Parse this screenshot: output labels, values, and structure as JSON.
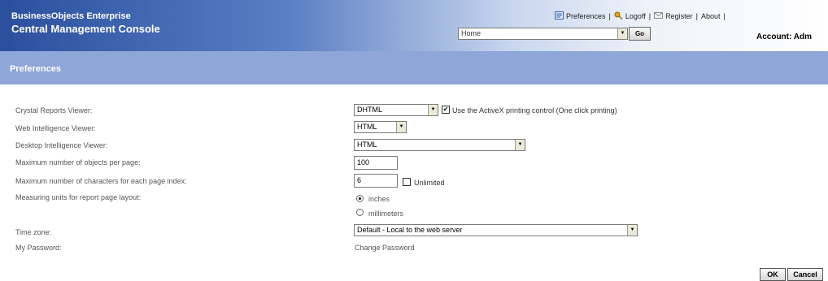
{
  "header": {
    "brand_line1": "BusinessObjects Enterprise",
    "brand_line2": "Central Management Console",
    "links": {
      "preferences": "Preferences",
      "logoff": "Logoff",
      "register": "Register",
      "about": "About"
    },
    "nav_select_value": "Home",
    "go_label": "Go",
    "account": "Account: Adm"
  },
  "page_title": "Preferences",
  "form": {
    "crystal_label": "Crystal Reports Viewer:",
    "crystal_value": "DHTML",
    "activex_checked": true,
    "activex_label": "Use the ActiveX printing control (One click printing)",
    "webi_label": "Web Intelligence Viewer:",
    "webi_value": "HTML",
    "deski_label": "Desktop Intelligence Viewer:",
    "deski_value": "HTML",
    "max_objects_label": "Maximum number of objects per page:",
    "max_objects_value": "100",
    "max_chars_label": "Maximum number of characters for each page index:",
    "max_chars_value": "6",
    "unlimited_checked": false,
    "unlimited_label": "Unlimited",
    "units_label": "Measuring units for report page layout:",
    "units_inches": "inches",
    "units_millimeters": "millimeters",
    "timezone_label": "Time zone:",
    "timezone_value": "Default - Local to the web server",
    "password_label": "My Password:",
    "change_password": "Change Password"
  },
  "actions": {
    "ok": "OK",
    "cancel": "Cancel"
  }
}
